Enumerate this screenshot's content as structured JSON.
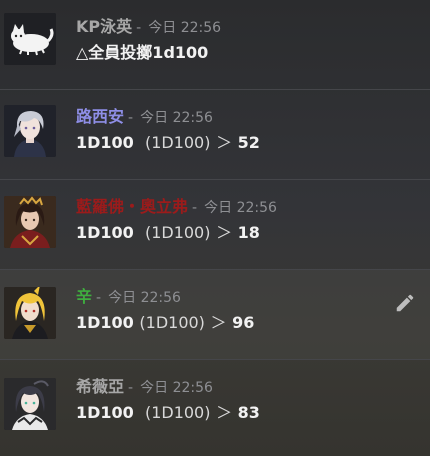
{
  "colors": {
    "name_kp": "#a7a7a7",
    "name_lu": "#8e8ee6",
    "name_po": "#9b1b1b",
    "name_xin": "#3fae3f",
    "name_xi": "#a7a7a7"
  },
  "messages": [
    {
      "name": "KP泳英",
      "sep": "-",
      "time": "今日 22:56",
      "text": "△全員投擲1d100",
      "avatar_icon": "white-cat-avatar"
    },
    {
      "name": "路西安",
      "sep": "-",
      "time": "今日 22:56",
      "dice": "1D100",
      "expr": "(1D100)",
      "arrow": "＞",
      "result": "52",
      "avatar_icon": "silver-hair-boy-avatar"
    },
    {
      "name": "藍羅佛・奧立弗",
      "sep": "-",
      "time": "今日 22:56",
      "dice": "1D100",
      "expr": "(1D100)",
      "arrow": "＞",
      "result": "18",
      "avatar_icon": "dark-hair-man-avatar"
    },
    {
      "name": "辛",
      "sep": "-",
      "time": "今日 22:56",
      "dice": "1D100",
      "expr": "(1D100)",
      "arrow": "＞",
      "result": "96",
      "avatar_icon": "blonde-girl-avatar",
      "edit_icon": "pencil-icon"
    },
    {
      "name": "希薇亞",
      "sep": "-",
      "time": "今日 22:56",
      "dice": "1D100",
      "expr": "(1D100)",
      "arrow": "＞",
      "result": "83",
      "avatar_icon": "dark-hair-girl-avatar"
    }
  ]
}
